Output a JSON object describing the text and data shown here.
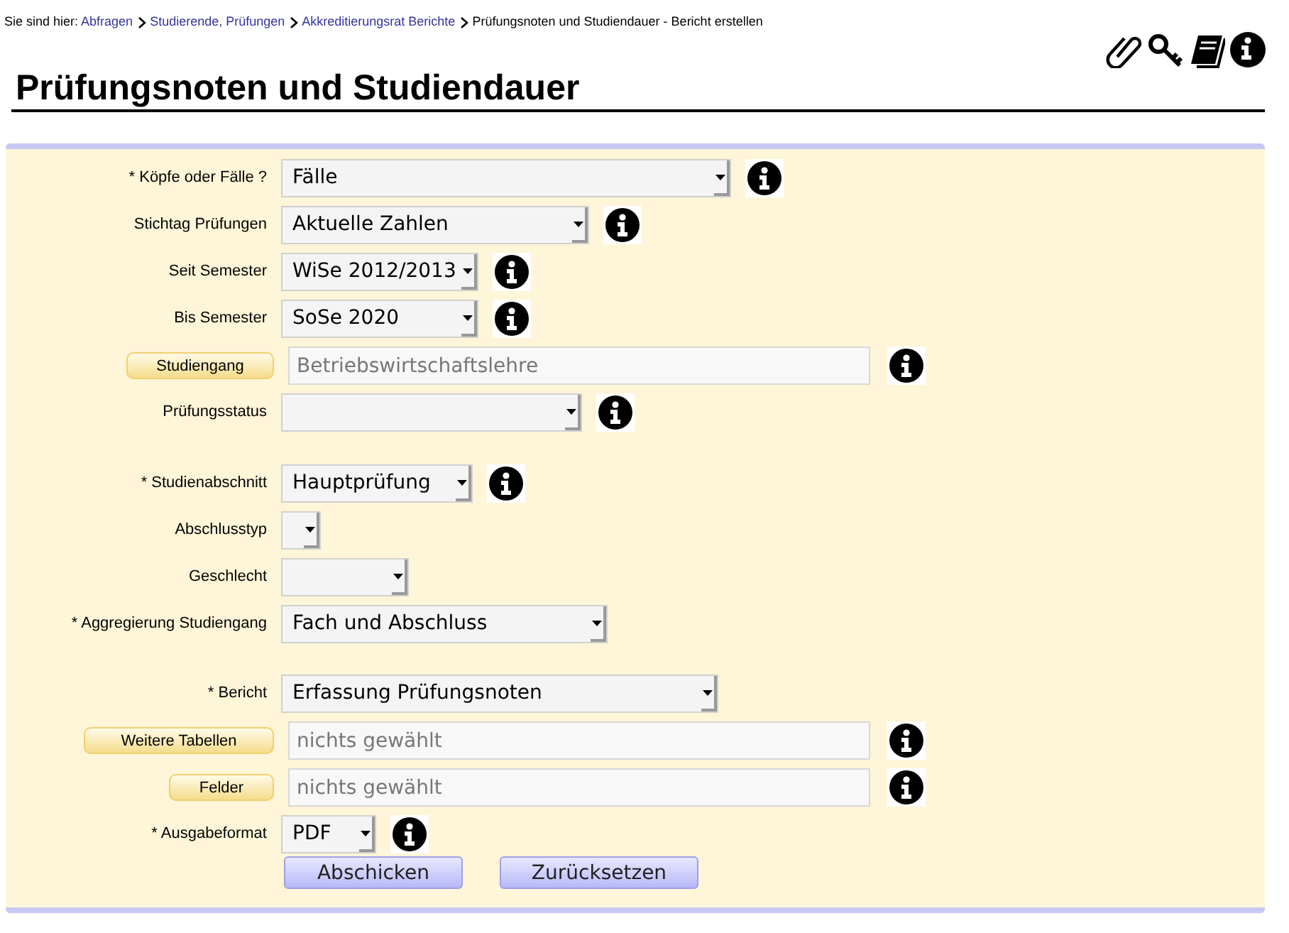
{
  "breadcrumb": {
    "prefix": "Sie sind hier:",
    "links": [
      "Abfragen",
      "Studierende, Prüfungen",
      "Akkreditierungsrat Berichte"
    ],
    "current": "Prüfungsnoten und Studiendauer - Bericht erstellen"
  },
  "title": "Prüfungsnoten und Studiendauer",
  "groups": [
    {
      "rows": [
        {
          "kind": "select",
          "label": "* Köpfe oder Fälle ?",
          "value": "Fälle",
          "info": true
        },
        {
          "kind": "select",
          "label": "Stichtag Prüfungen",
          "value": "Aktuelle Zahlen",
          "info": true
        },
        {
          "kind": "select",
          "label": "Seit Semester",
          "value": "WiSe 2012/2013",
          "info": true
        },
        {
          "kind": "select",
          "label": "Bis Semester",
          "value": "SoSe 2020",
          "info": true
        },
        {
          "kind": "lookup",
          "label": "Studiengang",
          "placeholder": "Betriebswirtschaftslehre",
          "info": true
        },
        {
          "kind": "select",
          "label": "Prüfungsstatus",
          "info": true
        }
      ]
    },
    {
      "rows": [
        {
          "kind": "select",
          "label": "* Studienabschnitt",
          "value": "Hauptprüfung",
          "info": true
        },
        {
          "kind": "select",
          "label": "Abschlusstyp",
          "info": false
        },
        {
          "kind": "select",
          "label": "Geschlecht",
          "info": false
        },
        {
          "kind": "select",
          "label": "* Aggregierung Studiengang",
          "value": "Fach und Abschluss",
          "info": false
        }
      ]
    },
    {
      "rows": [
        {
          "kind": "select",
          "label": "* Bericht",
          "value": "Erfassung Prüfungsnoten",
          "info": false
        },
        {
          "kind": "lookup",
          "label": "Weitere Tabellen",
          "placeholder": "nichts gewählt",
          "info": true
        },
        {
          "kind": "lookup",
          "label": "Felder",
          "placeholder": "nichts gewählt",
          "info": true
        },
        {
          "kind": "select",
          "label": "* Ausgabeformat",
          "value": "PDF",
          "info": true
        }
      ]
    }
  ],
  "buttons": [
    "Abschicken",
    "Zurücksetzen"
  ]
}
